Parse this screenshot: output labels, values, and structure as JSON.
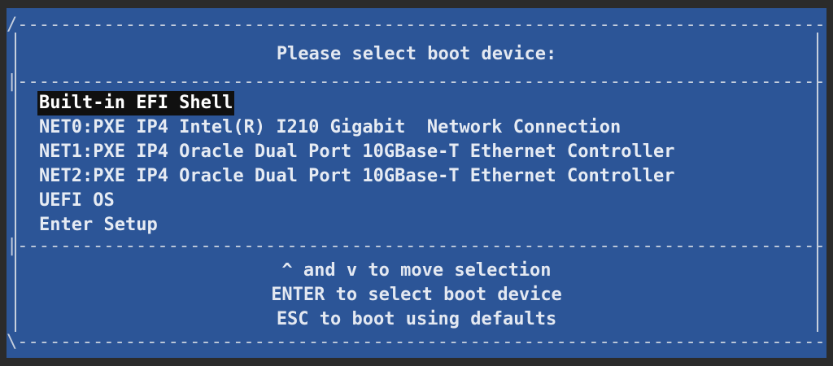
{
  "dialog": {
    "title": "Please select boot device:",
    "colors": {
      "background": "#2c5597",
      "text": "#e6ebf3",
      "selection_bg": "#101010",
      "page_bg": "#2b2b2b"
    }
  },
  "menu": {
    "items": [
      {
        "label": "Built-in EFI Shell",
        "selected": true
      },
      {
        "label": "NET0:PXE IP4 Intel(R) I210 Gigabit  Network Connection",
        "selected": false
      },
      {
        "label": "NET1:PXE IP4 Oracle Dual Port 10GBase-T Ethernet Controller",
        "selected": false
      },
      {
        "label": "NET2:PXE IP4 Oracle Dual Port 10GBase-T Ethernet Controller",
        "selected": false
      },
      {
        "label": "UEFI OS",
        "selected": false
      },
      {
        "label": "Enter Setup",
        "selected": false
      }
    ]
  },
  "help": {
    "line1": "^ and v to move selection",
    "line2": "ENTER to select boot device",
    "line3": "ESC to boot using defaults"
  }
}
